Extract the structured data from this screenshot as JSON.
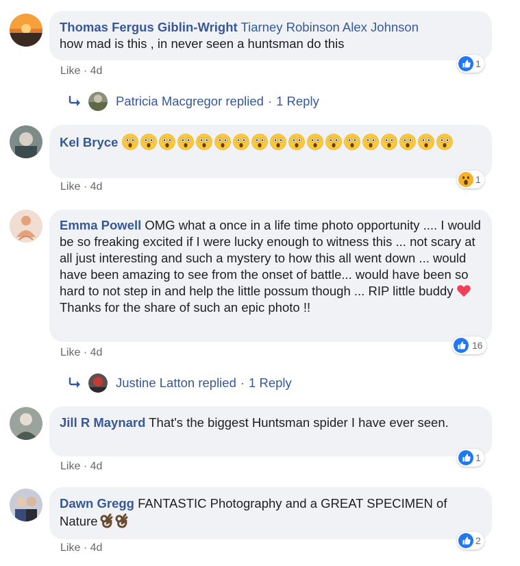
{
  "colors": {
    "link": "#365899",
    "bubble": "#f0f2f5",
    "like_blue": "#2078f4",
    "meta": "#65676b",
    "heart": "#f33e58",
    "wow": "#f7b125"
  },
  "comments": [
    {
      "author": "Thomas Fergus Giblin-Wright",
      "tags": "Tiarney Robinson Alex Johnson",
      "text": "how mad is this , in never seen a huntsman do this",
      "like_label": "Like",
      "time": "· 4d",
      "reaction_icon": "like-icon",
      "reaction_count": "1",
      "reply": {
        "name": "Patricia Macgregor replied",
        "sep": "·",
        "count": "1 Reply"
      }
    },
    {
      "author": "Kel Bryce",
      "emoji_count": 18,
      "emoji_name": "astonished-face-emoji",
      "like_label": "Like",
      "time": "· 4d",
      "reaction_icon": "wow-icon",
      "reaction_count": "1"
    },
    {
      "author": "Emma Powell",
      "text_before_heart": "OMG what a once in a life time photo opportunity .... I would be so freaking excited if I were lucky enough to witness this ... not scary at all just interesting and such a mystery to how this all went down ... would have been amazing to see from the onset of battle... would have been so hard to not step in and help the little possum though ... RIP little buddy",
      "text_after_heart": "Thanks for the share of such an epic photo !!",
      "like_label": "Like",
      "time": "· 4d",
      "reaction_icon": "like-icon",
      "reaction_count": "16",
      "reply": {
        "name": "Justine Latton replied",
        "sep": "·",
        "count": "1 Reply"
      }
    },
    {
      "author": "Jill R Maynard",
      "text": "That's the biggest Huntsman spider I have ever seen.",
      "like_label": "Like",
      "time": "· 4d",
      "reaction_icon": "like-icon",
      "reaction_count": "1"
    },
    {
      "author": "Dawn Gregg",
      "text": "FANTASTIC Photography and a GREAT SPECIMEN of Nature",
      "like_label": "Like",
      "time": "· 4d",
      "reaction_icon": "like-icon",
      "reaction_count": "2"
    }
  ]
}
